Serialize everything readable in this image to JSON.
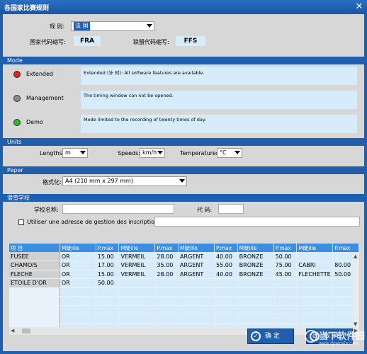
{
  "window": {
    "title": "各国家比赛规则"
  },
  "rules": {
    "rule_label": "规 则:",
    "rule_value": "法 国",
    "country_code_label": "国家代码缩写:",
    "country_code": "FRA",
    "federation_code_label": "联盟代码缩写:",
    "federation_code": "FFS"
  },
  "mode": {
    "heading": "Mode",
    "items": [
      {
        "name": "Extended",
        "color": "#e02020",
        "description": "Extended (计   时): All software features are available."
      },
      {
        "name": "Management",
        "color": "#8a8a8a",
        "description": "The timing window can not be opened."
      },
      {
        "name": "Demo",
        "color": "#22c022",
        "description": "Mode limited to the recording of twenty times of day."
      }
    ]
  },
  "units": {
    "heading": "Units",
    "lengths_label": "Lengths:",
    "lengths_value": "m",
    "speeds_label": "Speeds:",
    "speeds_value": "km/h",
    "temperatures_label": "Temperatures:",
    "temperatures_value": "°C"
  },
  "paper": {
    "heading": "Paper",
    "format_label": "格式化:",
    "format_value": "A4 (210 mm x 297 mm)"
  },
  "school": {
    "heading": "滑雪学校",
    "name_label": "学校名称:",
    "code_label": "代  码:",
    "checkbox_label": "Utiliser une adresse de gestion des inscription dédié"
  },
  "table": {
    "columns": [
      "项  目",
      "M陡ille",
      "P.max",
      "M陡ille",
      "P.max",
      "M陡ille",
      "P.max",
      "M陡ille",
      "P.max",
      "M陡ille",
      "P.max"
    ],
    "rows": [
      [
        "FUSEE",
        "OR",
        "15.00",
        "VERMEIL",
        "28.00",
        "ARGENT",
        "40.00",
        "BRONZE",
        "50.00",
        "",
        ""
      ],
      [
        "CHAMOIS",
        "OR",
        "17.00",
        "VERMEIL",
        "35.00",
        "ARGENT",
        "55.00",
        "BRONZE",
        "75.00",
        "CABRI",
        "80.00"
      ],
      [
        "FLECHE",
        "OR",
        "15.00",
        "VERMEIL",
        "28.00",
        "ARGENT",
        "40.00",
        "BRONZE",
        "45.00",
        "FLECHETTE",
        "50.00"
      ],
      [
        "ETOILE D'OR",
        "OR",
        "50.00",
        "",
        "",
        "",
        "",
        "",
        "",
        "",
        ""
      ]
    ],
    "empty_rows": 5
  },
  "buttons": {
    "ok_label": "确  定",
    "cancel_label": "取  消"
  },
  "watermark": {
    "main": "当下软件园",
    "sub": "www.downxia.com"
  },
  "colors": {
    "accent": "#1f5fae",
    "header": "#3b8ee0",
    "field_bg": "#d6ecfa"
  }
}
